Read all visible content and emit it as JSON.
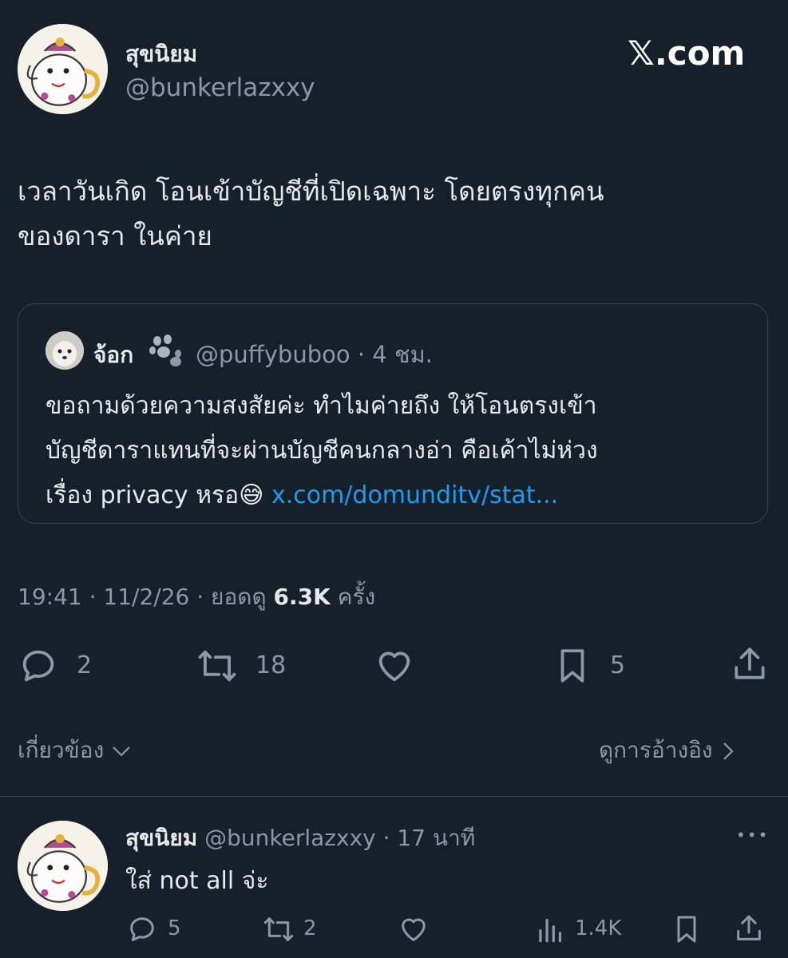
{
  "brand": "𝕏.com",
  "author": {
    "name": "สุขนิยม",
    "handle": "@bunkerlazxxy"
  },
  "tweet": {
    "lines": [
      "เวลาวันเกิด โอนเข้าบัญชีที่เปิดเฉพาะ โดยตรงทุกคน",
      "ของดารา ในค่าย"
    ]
  },
  "quote": {
    "name": "จ้อก",
    "handle": "@puffybuboo",
    "time": "· 4 ชม.",
    "lines": [
      "ขอถามด้วยความสงสัยค่ะ ทำไมค่ายถึง ให้โอนตรงเข้า",
      "บัญชีดาราแทนที่จะผ่านบัญชีคนกลางอ่า คือเค้าไม่ห่วง"
    ],
    "line3_text": "เรื่อง privacy หรอ",
    "emoji": "😅",
    "link": "x.com/domunditv/stat..."
  },
  "meta": {
    "time": "19:41 · 11/2/26 · ยอดดู",
    "views": "6.3K",
    "views_suffix": "ครั้ง"
  },
  "actions": {
    "replies": "2",
    "retweets": "18",
    "bookmarks": "5"
  },
  "bar": {
    "related": "เกี่ยวข้อง",
    "quotes": "ดูการอ้างอิง"
  },
  "reply": {
    "name": "สุขนิยม",
    "handle": "@bunkerlazxxy",
    "time": "· 17 นาที",
    "more": "•••",
    "text": "ใส่ not all จ่ะ",
    "replies": "5",
    "retweets": "2",
    "views": "1.4K"
  },
  "colors": {
    "background": "#15202b",
    "text": "#e7e9ea",
    "muted": "#8b98a5",
    "link": "#1d9bf0",
    "border": "#38444d"
  }
}
